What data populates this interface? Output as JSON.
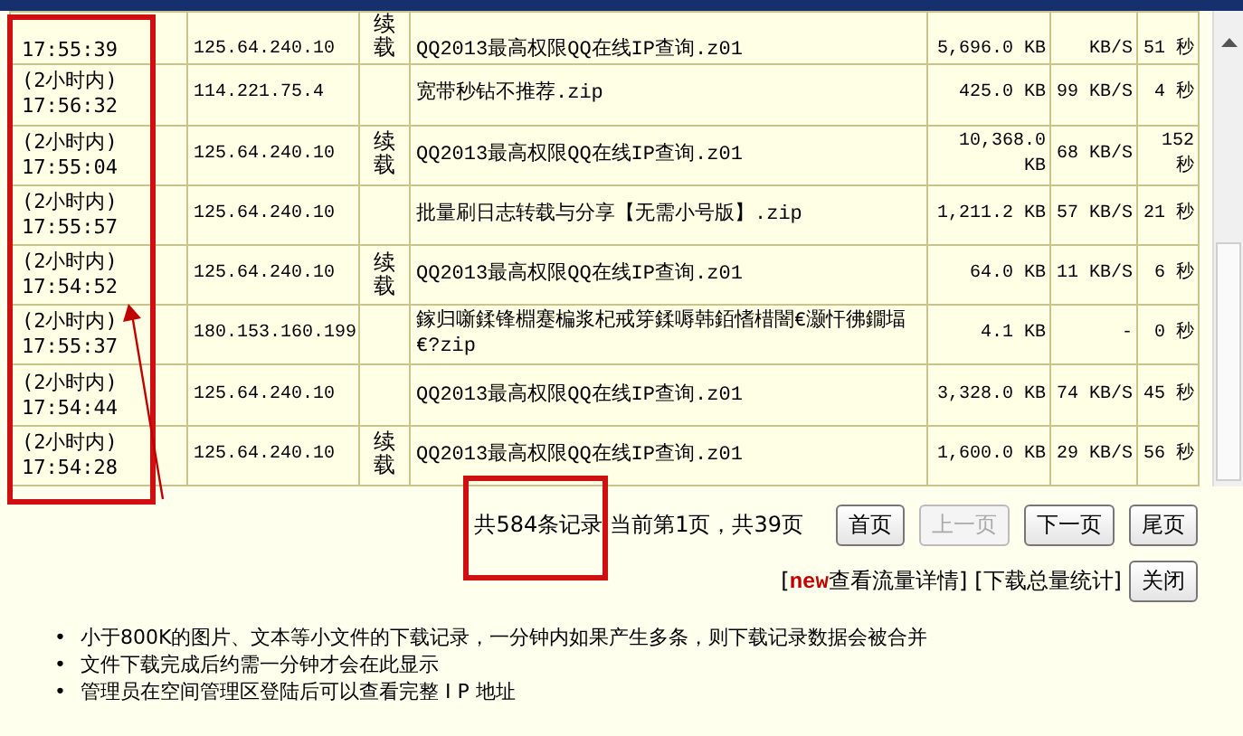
{
  "table": {
    "rows": [
      {
        "time": "17:55:39",
        "ip": "125.64.240.10",
        "flag": "续载",
        "file": "QQ2013最高权限QQ在线IP查询.z01",
        "size": "5,696.0 KB",
        "speed": "KB/S",
        "duration": "51 秒"
      },
      {
        "period": "(2小时内)",
        "time": "17:56:32",
        "ip": "114.221.75.4",
        "file": "宽带秒钻不推荐.zip",
        "size": "425.0 KB",
        "speed": "99 KB/S",
        "duration": "4 秒"
      },
      {
        "period": "(2小时内)",
        "time": "17:55:04",
        "ip": "125.64.240.10",
        "flag": "续载",
        "file": "QQ2013最高权限QQ在线IP查询.z01",
        "size": "10,368.0 KB",
        "speed": "68 KB/S",
        "duration": "152 秒"
      },
      {
        "period": "(2小时内)",
        "time": "17:55:57",
        "ip": "125.64.240.10",
        "file": "批量刷日志转载与分享【无需小号版】.zip",
        "size": "1,211.2 KB",
        "speed": "57 KB/S",
        "duration": "21 秒"
      },
      {
        "period": "(2小时内)",
        "time": "17:54:52",
        "ip": "125.64.240.10",
        "flag": "续载",
        "file": "QQ2013最高权限QQ在线IP查询.z01",
        "size": "64.0 KB",
        "speed": "11 KB/S",
        "duration": "6 秒"
      },
      {
        "period": "(2小时内)",
        "time": "17:55:37",
        "ip": "180.153.160.199",
        "file": "鎵归噺鍒锋棩蹇楄浆杞戒笌鍒嗕韩銆愭棤闇€灏忓彿鐗堛€?zip",
        "size": "4.1 KB",
        "speed": "-",
        "duration": "0 秒"
      },
      {
        "period": "(2小时内)",
        "time": "17:54:44",
        "ip": "125.64.240.10",
        "file": "QQ2013最高权限QQ在线IP查询.z01",
        "size": "3,328.0 KB",
        "speed": "74 KB/S",
        "duration": "45 秒"
      },
      {
        "period": "(2小时内)",
        "time": "17:54:28",
        "ip": "125.64.240.10",
        "flag": "续载",
        "file": "QQ2013最高权限QQ在线IP查询.z01",
        "size": "1,600.0 KB",
        "speed": "29 KB/S",
        "duration": "56 秒"
      }
    ]
  },
  "pagination": {
    "summary": [
      "共584条记录",
      "当前第1页，共39页"
    ],
    "buttons": [
      {
        "label": "首页",
        "disabled": false
      },
      {
        "label": "上一页",
        "disabled": true
      },
      {
        "label": "下一页",
        "disabled": false
      },
      {
        "label": "尾页",
        "disabled": false
      }
    ]
  },
  "links": [
    {
      "prefix": "[",
      "badge": "new",
      "label": "查看流量详情]"
    },
    {
      "label": "[下载总量统计]"
    }
  ],
  "close_button": "关闭",
  "notes": [
    {
      "marker": "•",
      "text": "小于800K的图片、文本等小文件的下载记录，一分钟内如果产生多条，则下载记录数据会被合并"
    },
    {
      "marker": "•",
      "text": "文件下载完成后约需一分钟才会在此显示"
    },
    {
      "marker": "•",
      "text": "管理员在空间管理区登陆后可以查看完整 I P 地址"
    }
  ]
}
